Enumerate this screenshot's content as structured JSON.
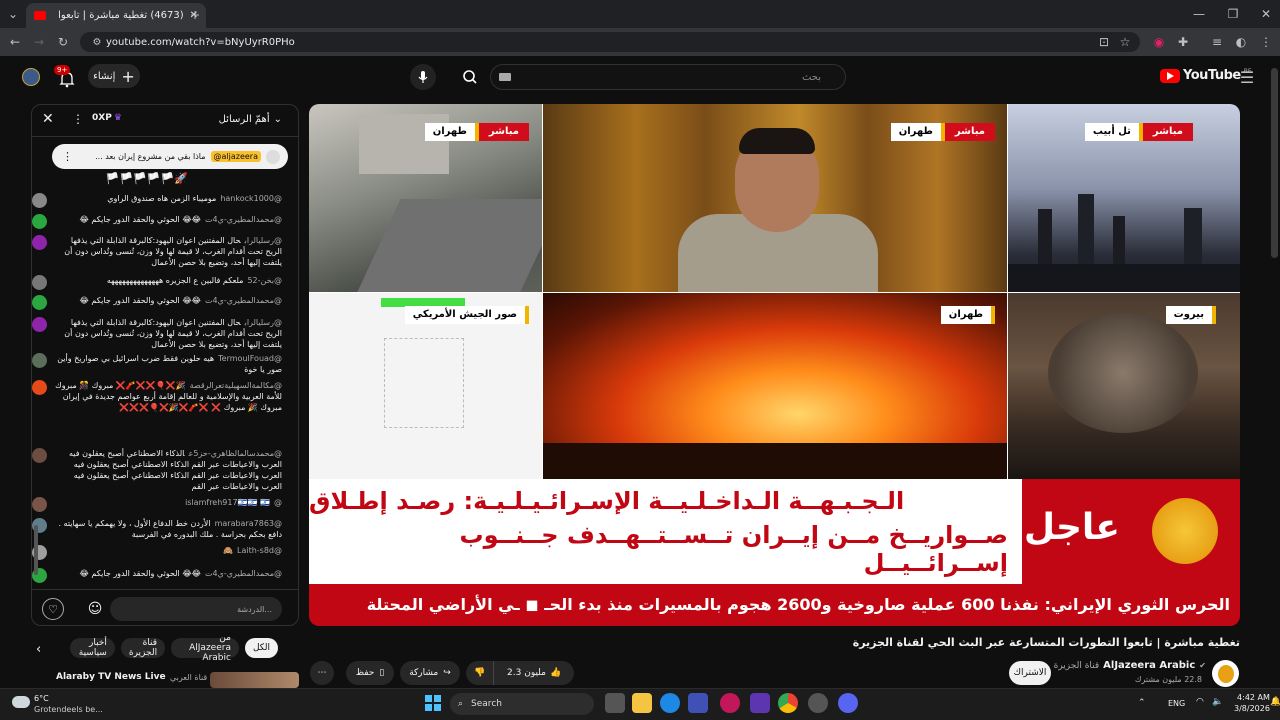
{
  "browser": {
    "tab_title": "(4673) تغطية مباشرة | تابعوا",
    "url": "youtube.com/watch?v=bNyUyrR0PHo"
  },
  "yt_header": {
    "logo_text": "YouTube",
    "region": "BE",
    "search_placeholder": "بحث",
    "create_label": "إنشاء",
    "notif_count": "9+"
  },
  "chat": {
    "header_title": "أهمّ الرسائل",
    "xp_label": "0XP",
    "pinned_channel": "@aljazeera",
    "pinned_text": "ماذا بقي من مشروع إيران بعد ...",
    "flags_row": "🏳️🏳️🏳️🏳️🏳️🚀",
    "messages": [
      {
        "user": "@hankock1000",
        "text": "موميباء الزمن هاه صندوق الراوي",
        "color": "#888"
      },
      {
        "user": "@محمدالمطيري-ي4ت",
        "text": "😂😂 الحوثي والحقد الدور جايكم 😂",
        "color": "#2ba640"
      },
      {
        "user": "@رسليالراب",
        "text": "حال المفتنين اعوان اليهود:كالبرقة الذابلة التي يذفها الريح تحت أقدام الغرب، لا قيمة لها ولا وزن، تُنسى وتُداس دون أن يلتفت إليها أحد، وتضيع بلا حصن الأعمال",
        "color": "#8e24aa"
      },
      {
        "user": "@بخن-52",
        "text": "ملعكم فالبين ع الجزيره ههههههههههههههه",
        "color": "#777"
      },
      {
        "user": "@محمدالمطيري-ي4ت",
        "text": "😂😂 الحوثي والحقد الدور جايكم 😂",
        "color": "#2ba640"
      },
      {
        "user": "@رسليالراب",
        "text": "حال المفتنين اعوان اليهود:كالبرقة الذابلة التي يذفها الريح تحت أقدام الغرب، لا قيمة لها ولا وزن، تُنسى وتُداس دون أن يلتفت إليها أحد، وتضيع بلا حصن الأعمال",
        "color": "#8e24aa"
      },
      {
        "user": "@TermoulFouad",
        "text": "هيه حلوين فقط ضرب اسرائيل بي صواريخ وأين صور يا خوة",
        "color": "#5a6e5a"
      },
      {
        "user": "@مكالمةالسهيليةتعرالرقصة",
        "text": "🎉❌🎈❌❌🧨❌ مبروك 🎊 مبروك للأمة العربية والإسلامية و للعالم إقامة أربع عواصم جديدة في إيران مبروك 🎉 مبروك ❌ ❌🧨❌🎉❌🎈❌❌❌",
        "color": "#e64a19"
      },
      {
        "user": "@محمدسالمالظاهري-حز5ع",
        "text": "الذكاء الاصطناعي أصبح يعقلون فيه العرب والاعياطات عبر القم الذكاء الاصطناعي أصبح يعقلون فيه العرب والاعياطات عبر القم الذكاء الاصطناعي أصبح يعقلون فيه العرب والاعياطات عبر القم",
        "color": "#6d4c41"
      },
      {
        "user": "@islamfreh917",
        "text": "🇮🇱🇮🇱 🇮🇱",
        "color": "#795548"
      },
      {
        "user": "@marabara7863",
        "text": "الأردن خط الدفاع الأول ، ولا يهمكم يا سهايته . دافع بحكم بحراسة . ملك البدوره في الفرسبة",
        "color": "#607d8b"
      },
      {
        "user": "@Laith-s8d",
        "text": "🙈",
        "color": "#9e9e9e"
      },
      {
        "user": "@محمدالمطيري-ي4ت",
        "text": "😂😂 الحوثي والحقد الدور جايكم 😂",
        "color": "#2ba640"
      }
    ],
    "input_placeholder": "الدردشة..."
  },
  "video": {
    "panes": [
      {
        "live": "مباشر",
        "place": "طهران"
      },
      {
        "live": "مباشر",
        "place": "طهران"
      },
      {
        "live": "مباشر",
        "place": "تل أبيب"
      },
      {
        "live": "",
        "place": "صور الجيش الأمريكي"
      },
      {
        "live": "",
        "place": "طهران"
      },
      {
        "live": "",
        "place": "بيروت"
      }
    ],
    "breaking_label": "عاجل",
    "headline_line1": "الـجـبـهــة الـداخـلـيــة الإسـرائـيـلـيـة: رصـد إطـلاق",
    "headline_line2": "صــواريــخ مــن إيــران تــســتــهــدف جــنــوب إســرائــيــل",
    "ticker": "الحرس الثوري الإيراني: نفذنا 600 عملية صاروخية و2600 هجوم بالمسيرات منذ بدء الحـ  ◼  ـي الأراضي المحتلة"
  },
  "below": {
    "chips": [
      "الكل",
      "من AlJazeera Arabic",
      "قناة الجزيرة",
      "أخبار سياسية"
    ],
    "title": "تغطية مباشرة | تابعوا التطورات المتسارعة عبر البث الحي لقناة الجزيرة",
    "channel_name": "AlJazeera Arabic",
    "channel_ar": "قناة الجزيرة",
    "subscribers": "22.8 مليون مشترك",
    "subscribe_label": "الاشتراك",
    "likes": "2.3 مليون",
    "share_label": "مشاركة",
    "save_label": "حفظ",
    "rec_title": "Alaraby TV News Live",
    "rec_channel": "قناة العربي"
  },
  "taskbar": {
    "weather_temp": "6°C",
    "weather_desc": "Grotendeels be...",
    "search_label": "Search",
    "lang": "ENG",
    "time": "4:42 AM",
    "date": "3/8/2026"
  }
}
